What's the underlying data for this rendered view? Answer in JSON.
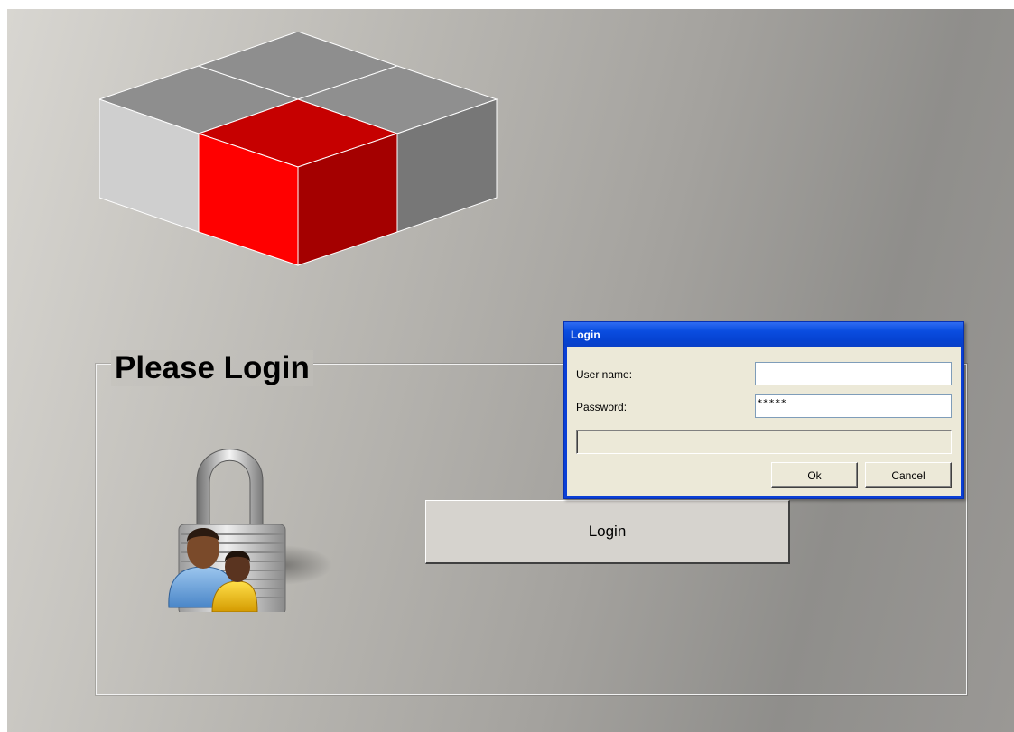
{
  "main": {
    "group_title": "Please Login",
    "login_button_label": "Login"
  },
  "logo": {
    "name": "cube-logo-icon",
    "colors": {
      "accent_front": "#ff0000",
      "accent_side": "#a40000",
      "accent_top": "#c60000"
    }
  },
  "icons": {
    "lock": "lock-users-icon"
  },
  "dialog": {
    "title": "Login",
    "username_label": "User name:",
    "username_value": "",
    "password_label": "Password:",
    "password_value": "*****",
    "status_text": "",
    "ok_label": "Ok",
    "cancel_label": "Cancel"
  },
  "colors": {
    "titlebar": "#0a4de0",
    "dialog_body": "#ece9d8",
    "button_face": "#d6d3ce"
  }
}
